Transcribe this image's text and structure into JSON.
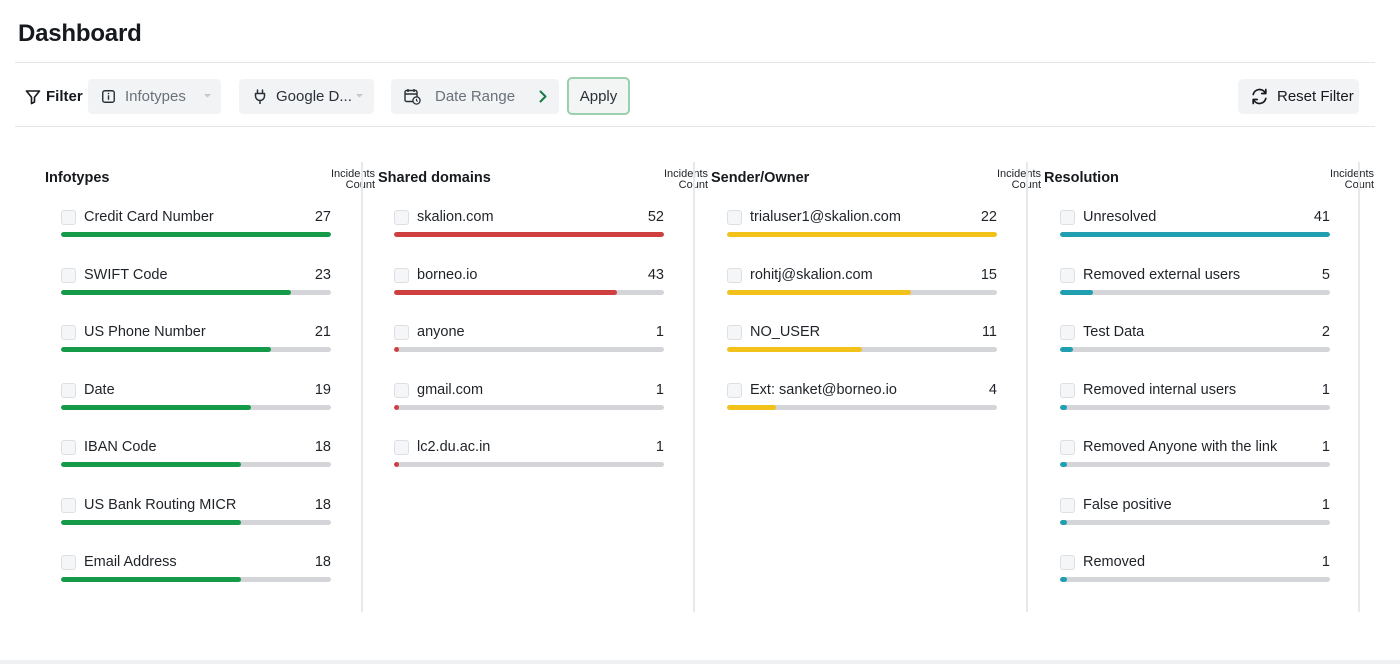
{
  "title": "Dashboard",
  "filter_bar": {
    "filter_label": "Filter",
    "infotypes_placeholder": "Infotypes",
    "source_value": "Google D...",
    "date_range_placeholder": "Date Range",
    "apply_label": "Apply",
    "reset_label": "Reset Filter"
  },
  "colors": {
    "infotypes": "#159a4a",
    "shared_domains": "#cf3f3f",
    "sender_owner": "#f2c21a",
    "resolution": "#1f9fb0",
    "track": "#d3d5d8",
    "apply_border": "#9ad0b0"
  },
  "count_header": "Incidents Count",
  "panels": [
    {
      "key": "infotypes",
      "title": "Infotypes",
      "max": 27,
      "items": [
        {
          "label": "Credit Card Number",
          "count": 27
        },
        {
          "label": "SWIFT Code",
          "count": 23
        },
        {
          "label": "US Phone Number",
          "count": 21
        },
        {
          "label": "Date",
          "count": 19
        },
        {
          "label": "IBAN Code",
          "count": 18
        },
        {
          "label": "US Bank Routing MICR",
          "count": 18
        },
        {
          "label": "Email Address",
          "count": 18
        }
      ]
    },
    {
      "key": "shared_domains",
      "title": "Shared domains",
      "max": 52,
      "items": [
        {
          "label": "skalion.com",
          "count": 52
        },
        {
          "label": "borneo.io",
          "count": 43
        },
        {
          "label": "anyone",
          "count": 1
        },
        {
          "label": "gmail.com",
          "count": 1
        },
        {
          "label": "lc2.du.ac.in",
          "count": 1
        }
      ]
    },
    {
      "key": "sender_owner",
      "title": "Sender/Owner",
      "max": 22,
      "items": [
        {
          "label": "trialuser1@skalion.com",
          "count": 22
        },
        {
          "label": "rohitj@skalion.com",
          "count": 15
        },
        {
          "label": "NO_USER",
          "count": 11
        },
        {
          "label": "Ext: sanket@borneo.io",
          "count": 4
        }
      ]
    },
    {
      "key": "resolution",
      "title": "Resolution",
      "max": 41,
      "items": [
        {
          "label": "Unresolved",
          "count": 41
        },
        {
          "label": "Removed external users",
          "count": 5
        },
        {
          "label": "Test Data",
          "count": 2
        },
        {
          "label": "Removed internal users",
          "count": 1
        },
        {
          "label": "Removed Anyone with the link",
          "count": 1
        },
        {
          "label": "False positive",
          "count": 1
        },
        {
          "label": "Removed",
          "count": 1
        }
      ]
    }
  ]
}
